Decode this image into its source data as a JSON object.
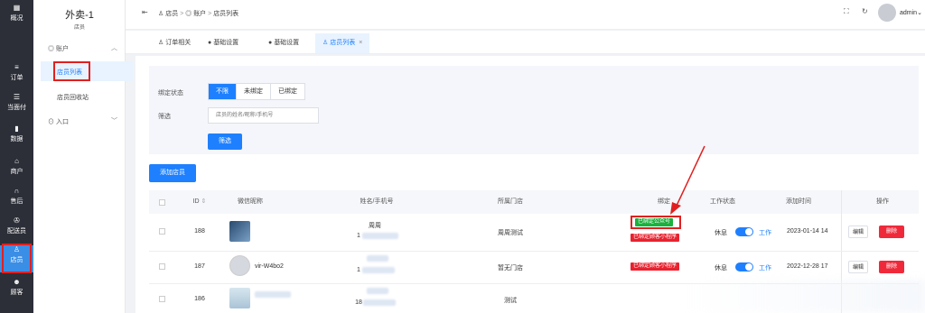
{
  "brand": {
    "title": "外卖-1",
    "subtitle": "店员"
  },
  "sidebar": [
    {
      "label": "概况",
      "icon": "dashboard-icon"
    },
    {
      "label": "订单",
      "icon": "order-icon"
    },
    {
      "label": "当面付",
      "icon": "pay-icon"
    },
    {
      "label": "数据",
      "icon": "chart-icon"
    },
    {
      "label": "商户",
      "icon": "shop-icon"
    },
    {
      "label": "售后",
      "icon": "headset-icon"
    },
    {
      "label": "配送员",
      "icon": "courier-icon"
    },
    {
      "label": "店员",
      "icon": "staff-icon"
    },
    {
      "label": "顾客",
      "icon": "customer-icon"
    }
  ],
  "subnav": {
    "group": "账户",
    "items": [
      "店员列表",
      "店员回收站"
    ],
    "entry": "入口"
  },
  "breadcrumb": [
    "店员",
    "账户",
    "店员列表"
  ],
  "user": "admin",
  "tabs": [
    "订单相关",
    "基础设置",
    "基础设置",
    "店员列表"
  ],
  "filter": {
    "bind_label": "绑定状态",
    "bind_options": [
      "不限",
      "未绑定",
      "已绑定"
    ],
    "filter_label": "筛选",
    "search_placeholder": "店员的姓名/昵称/手机号",
    "search_button": "筛选"
  },
  "add_button": "添加店员",
  "table": {
    "headers": [
      "ID",
      "微信昵称",
      "姓名/手机号",
      "所属门店",
      "绑定",
      "工作状态",
      "添加时间",
      "操作"
    ],
    "rows": [
      {
        "id": "188",
        "nickname": "",
        "name": "周周",
        "phone": "1",
        "store": "周周测试",
        "tags": [
          "已绑定公众号",
          "已绑定顾客小程序"
        ],
        "rest": "休息",
        "work": "工作",
        "time": "2023-01-14 14"
      },
      {
        "id": "187",
        "nickname": "vir-W4bo2",
        "name": "",
        "phone": "1",
        "store": "暂无门店",
        "tags": [
          "已绑定顾客小程序"
        ],
        "rest": "休息",
        "work": "工作",
        "time": "2022-12-28 17"
      },
      {
        "id": "186",
        "nickname": "",
        "name": "",
        "phone": "18",
        "store": "测试",
        "tags": [],
        "rest": "",
        "work": "",
        "time": ""
      }
    ],
    "edit": "编辑",
    "delete": "删除"
  }
}
